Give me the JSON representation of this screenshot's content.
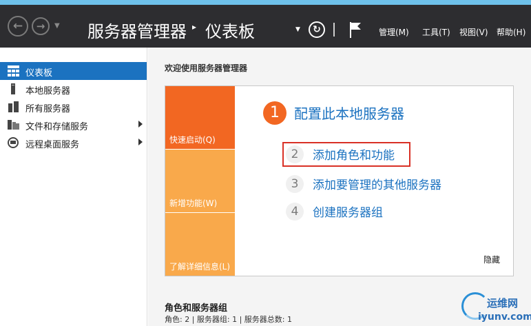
{
  "header": {
    "back_icon": "back-arrow-icon",
    "forward_icon": "forward-arrow-icon",
    "breadcrumb_root": "服务器管理器",
    "breadcrumb_separator": "▸",
    "breadcrumb_page": "仪表板",
    "refresh_icon": "refresh-icon",
    "flag_icon": "notification-flag-icon",
    "menu": {
      "manage": "管理(M)",
      "tools": "工具(T)",
      "view": "视图(V)",
      "help": "帮助(H)"
    }
  },
  "sidebar": {
    "items": [
      {
        "label": "仪表板",
        "icon": "dashboard-grid-icon",
        "active": true
      },
      {
        "label": "本地服务器",
        "icon": "server-icon"
      },
      {
        "label": "所有服务器",
        "icon": "servers-icon"
      },
      {
        "label": "文件和存储服务",
        "icon": "file-storage-icon",
        "expandable": true
      },
      {
        "label": "远程桌面服务",
        "icon": "remote-desktop-icon",
        "expandable": true
      }
    ]
  },
  "main": {
    "welcome": "欢迎使用服务器管理器",
    "tiles": {
      "quick_start": "快速启动(Q)",
      "whats_new": "新增功能(W)",
      "learn_more": "了解详细信息(L)"
    },
    "steps": [
      {
        "num": "1",
        "label": "配置此本地服务器"
      },
      {
        "num": "2",
        "label": "添加角色和功能"
      },
      {
        "num": "3",
        "label": "添加要管理的其他服务器"
      },
      {
        "num": "4",
        "label": "创建服务器组"
      }
    ],
    "hide": "隐藏",
    "roles_title": "角色和服务器组",
    "roles_summary": "角色: 2 | 服务器组: 1 | 服务器总数: 1"
  },
  "watermark": {
    "top": "运维网",
    "bottom": "iyunv.com"
  },
  "colors": {
    "titlebar": "#2d2d30",
    "accent_blue": "#1b72c0",
    "tile_orange": "#f26722",
    "tile_light_orange": "#f9a94b",
    "highlight_red": "#d93025"
  }
}
